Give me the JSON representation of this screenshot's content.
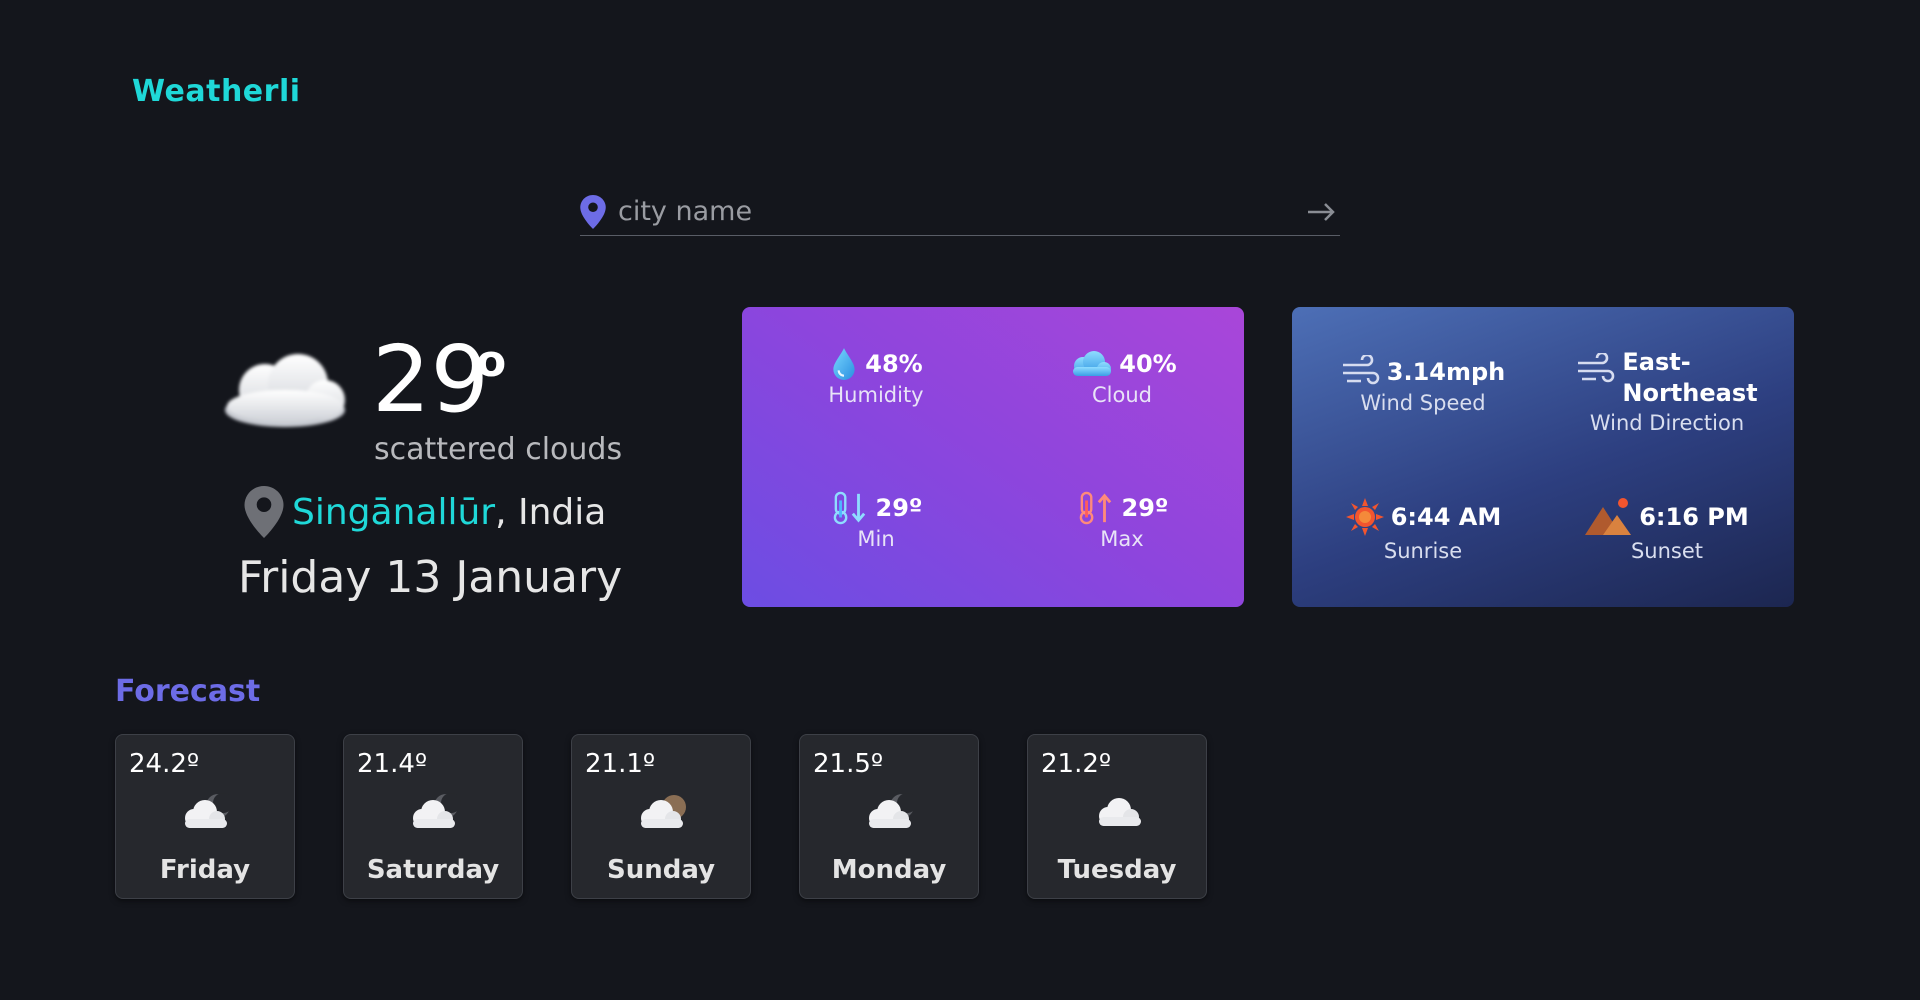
{
  "app": {
    "title": "Weatherli"
  },
  "search": {
    "placeholder": "city name"
  },
  "current": {
    "temperature": "29",
    "degree": "o",
    "description": "scattered clouds",
    "city": "Singānallūr",
    "country_sep": ", India",
    "date": "Friday 13 January",
    "icon": "cloud-icon"
  },
  "details": {
    "humidity": {
      "value": "48%",
      "label": "Humidity",
      "icon": "water-drop-icon"
    },
    "cloud": {
      "value": "40%",
      "label": "Cloud",
      "icon": "cloud-icon"
    },
    "min": {
      "value": "29º",
      "label": "Min",
      "icon": "thermometer-down-icon"
    },
    "max": {
      "value": "29º",
      "label": "Max",
      "icon": "thermometer-up-icon"
    }
  },
  "wind": {
    "speed": {
      "value": "3.14mph",
      "label": "Wind Speed",
      "icon": "wind-icon"
    },
    "direction": {
      "value_line1": "East-",
      "value_line2": "Northeast",
      "label": "Wind Direction",
      "icon": "wind-icon"
    },
    "sunrise": {
      "value": "6:44 AM",
      "label": "Sunrise",
      "icon": "sun-icon"
    },
    "sunset": {
      "value": "6:16 PM",
      "label": "Sunset",
      "icon": "mountain-sunset-icon"
    }
  },
  "forecast": {
    "title": "Forecast",
    "days": [
      {
        "temp": "24.2º",
        "day": "Friday",
        "icon": "cloud-moon-icon"
      },
      {
        "temp": "21.4º",
        "day": "Saturday",
        "icon": "cloud-moon-icon"
      },
      {
        "temp": "21.1º",
        "day": "Sunday",
        "icon": "cloud-moon-icon"
      },
      {
        "temp": "21.5º",
        "day": "Monday",
        "icon": "cloud-moon-icon"
      },
      {
        "temp": "21.2º",
        "day": "Tuesday",
        "icon": "cloud-icon"
      }
    ]
  },
  "colors": {
    "background": "#14161c",
    "brand": "#1fd8d8",
    "accent": "#6d6ce6",
    "purple_card": "#8d45dd",
    "blue_card": "#2d3f80"
  }
}
